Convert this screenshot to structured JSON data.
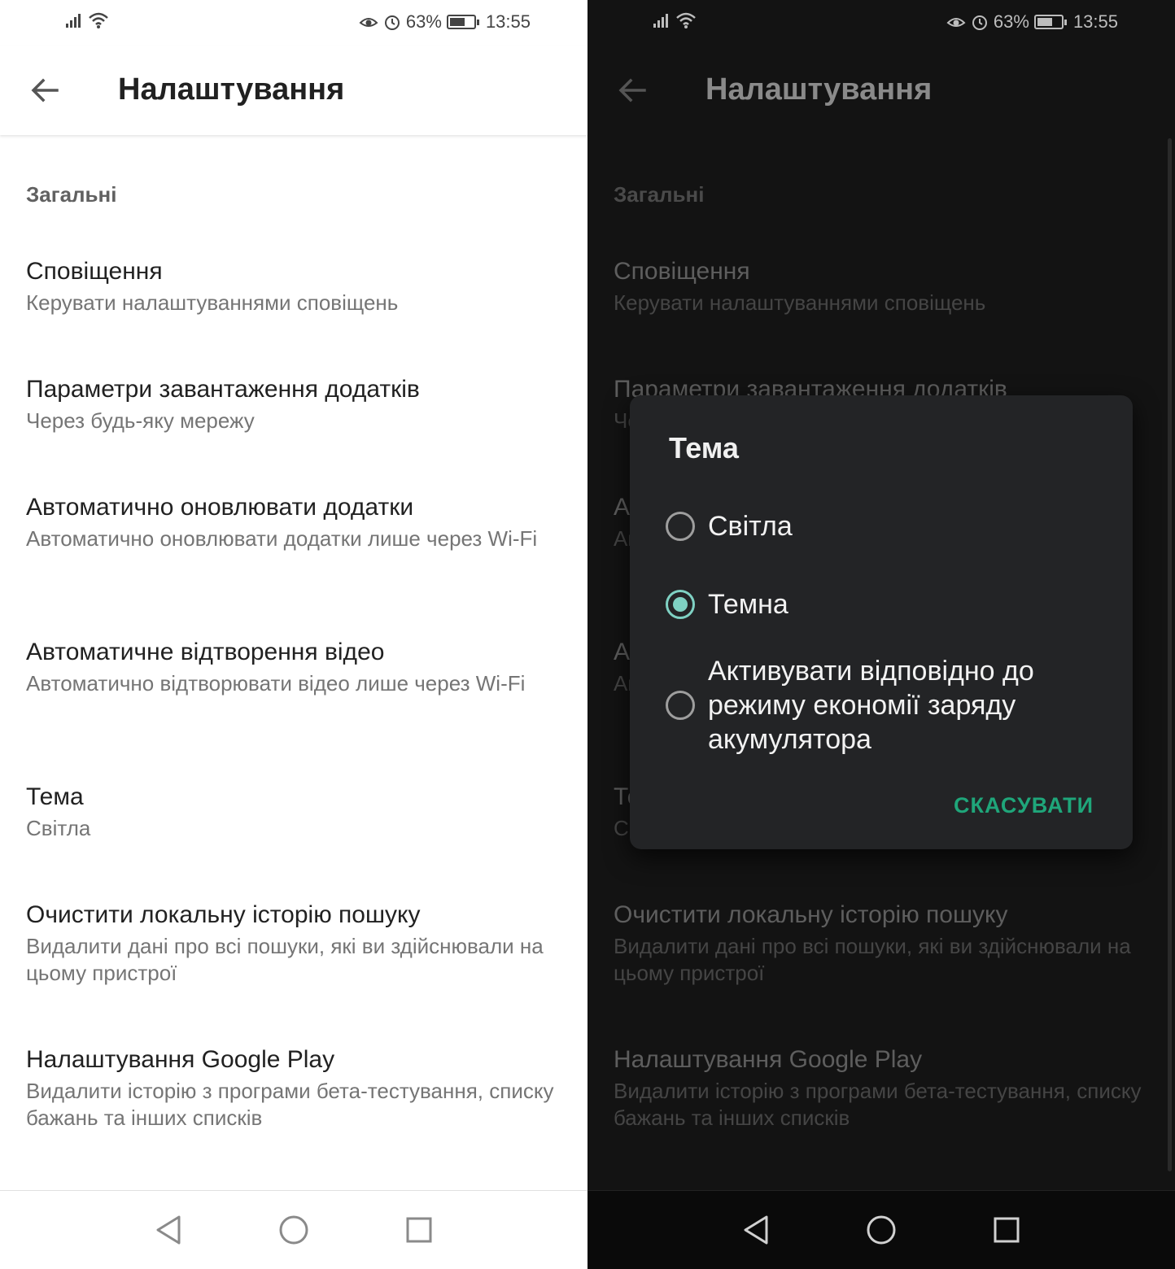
{
  "status": {
    "battery": "63%",
    "battery_level": 0.63,
    "time": "13:55"
  },
  "appbar": {
    "title": "Налаштування"
  },
  "section": {
    "general": "Загальні"
  },
  "items": [
    {
      "title": "Сповіщення",
      "subtitle": "Керувати налаштуваннями сповіщень"
    },
    {
      "title": "Параметри завантаження додатків",
      "subtitle": "Через будь-яку мережу"
    },
    {
      "title": "Автоматично оновлювати додатки",
      "subtitle": "Автоматично оновлювати додатки лише через Wi-Fi"
    },
    {
      "title": "Автоматичне відтворення відео",
      "subtitle": "Автоматично відтворювати відео лише через Wi-Fi"
    },
    {
      "title": "Тема",
      "subtitle": "Світла"
    },
    {
      "title": "Очистити локальну історію пошуку",
      "subtitle": "Видалити дані про всі пошуки, які ви здійснювали на цьому пристрої"
    },
    {
      "title": "Налаштування Google Play",
      "subtitle": "Видалити історію з програми бета-тестування, списку бажань та інших списків"
    }
  ],
  "dialog": {
    "title": "Тема",
    "options": [
      {
        "label": "Світла",
        "selected": false
      },
      {
        "label": "Темна",
        "selected": true
      },
      {
        "label": "Активувати відповідно до режиму економії заряду акумулятора",
        "selected": false
      }
    ],
    "cancel_label": "СКАСУВАТИ"
  },
  "colors": {
    "accent": "#1fa67a",
    "radio_selected": "#7fd1c3",
    "dark_background": "#131313",
    "dialog_background": "#232426"
  }
}
